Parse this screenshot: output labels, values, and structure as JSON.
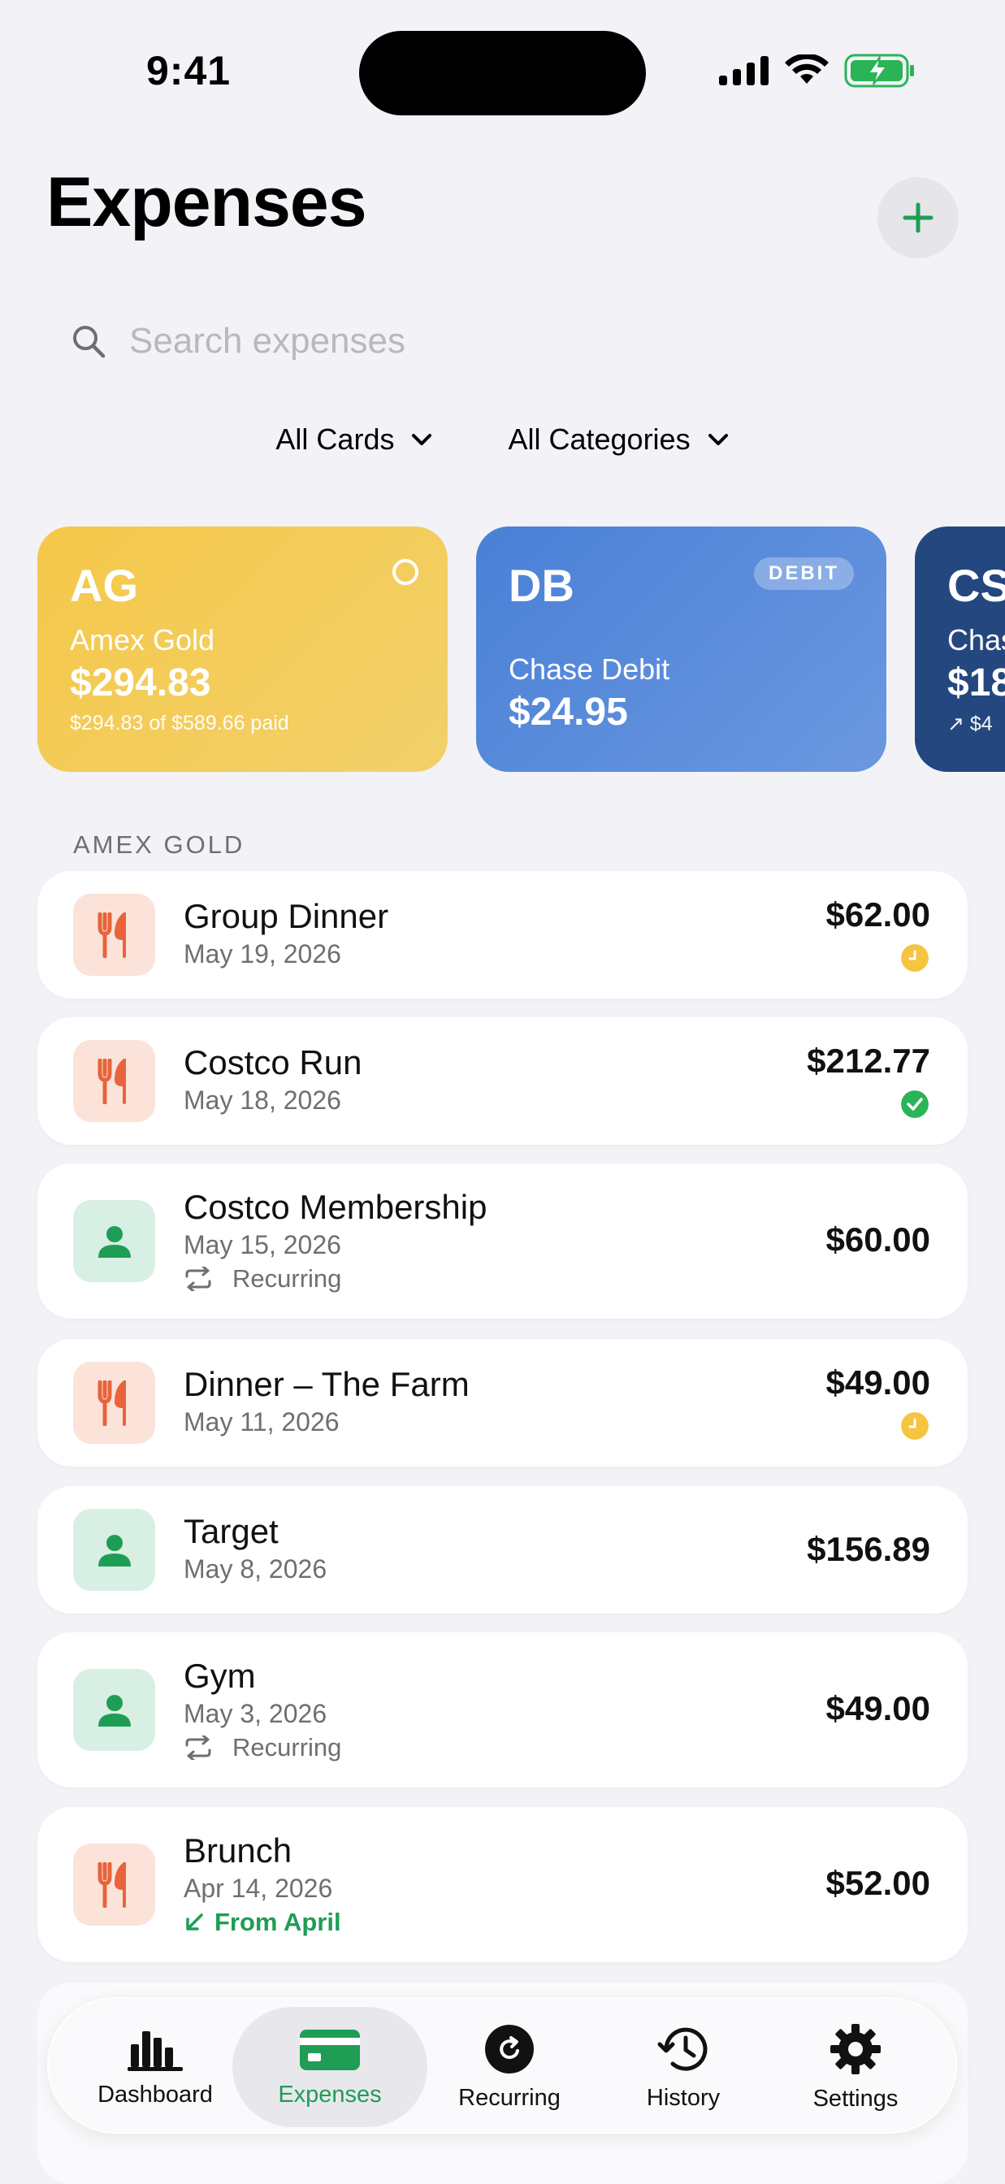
{
  "status": {
    "time": "9:41"
  },
  "header": {
    "title": "Expenses"
  },
  "search": {
    "placeholder": "Search expenses"
  },
  "filters": {
    "cards": "All Cards",
    "categories": "All Categories"
  },
  "cards": [
    {
      "abbr": "AG",
      "name": "Amex Gold",
      "amount": "$294.83",
      "sub": "$294.83 of $589.66 paid"
    },
    {
      "abbr": "DB",
      "name": "Chase Debit",
      "amount": "$24.95",
      "badge": "DEBIT"
    },
    {
      "abbr": "CS",
      "name": "Chas",
      "amount": "$18",
      "sub": "↗ $4"
    }
  ],
  "section": {
    "label": "AMEX GOLD"
  },
  "expenses": [
    {
      "title": "Group Dinner",
      "date": "May 19, 2026",
      "amount": "$62.00",
      "category": "food",
      "status": "pending"
    },
    {
      "title": "Costco Run",
      "date": "May 18, 2026",
      "amount": "$212.77",
      "category": "food",
      "status": "paid"
    },
    {
      "title": "Costco Membership",
      "date": "May 15, 2026",
      "amount": "$60.00",
      "category": "person",
      "note": "Recurring"
    },
    {
      "title": "Dinner – The Farm",
      "date": "May 11, 2026",
      "amount": "$49.00",
      "category": "food",
      "status": "pending"
    },
    {
      "title": "Target",
      "date": "May 8, 2026",
      "amount": "$156.89",
      "category": "person"
    },
    {
      "title": "Gym",
      "date": "May 3, 2026",
      "amount": "$49.00",
      "category": "person",
      "note": "Recurring"
    },
    {
      "title": "Brunch",
      "date": "Apr 14, 2026",
      "amount": "$52.00",
      "category": "food",
      "note": "From April"
    }
  ],
  "tabs": [
    {
      "label": "Dashboard",
      "icon": "chart-bars-icon"
    },
    {
      "label": "Expenses",
      "icon": "credit-card-icon"
    },
    {
      "label": "Recurring",
      "icon": "refresh-circle-icon"
    },
    {
      "label": "History",
      "icon": "history-icon"
    },
    {
      "label": "Settings",
      "icon": "gear-icon"
    }
  ],
  "colors": {
    "accent": "#1f9d55",
    "food": "#e8643a",
    "pending": "#f5c441",
    "paid": "#2bb457"
  }
}
